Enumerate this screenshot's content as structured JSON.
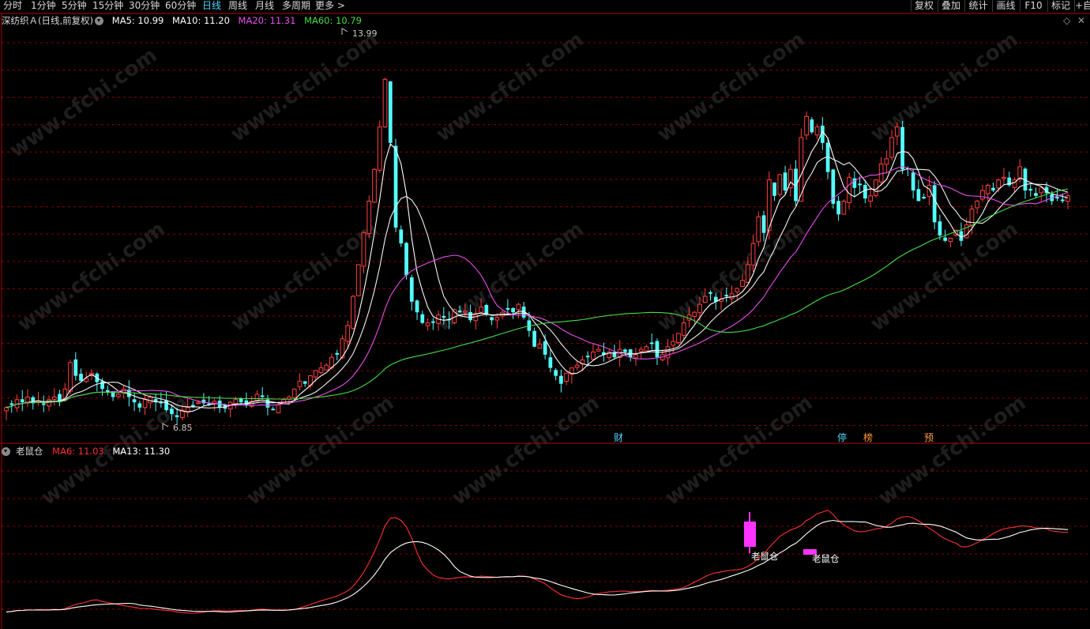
{
  "toolbar": {
    "periods": [
      "分时",
      "1分钟",
      "5分钟",
      "15分钟",
      "30分钟",
      "60分钟",
      "日线",
      "周线",
      "月线",
      "多周期",
      "更多 >"
    ],
    "active_period": "日线",
    "right_buttons": [
      "复权",
      "叠加",
      "统计",
      "画线",
      "F10",
      "标记",
      "+自"
    ],
    "pin_icons": [
      "diamond-icon",
      "close-icon"
    ]
  },
  "main_panel": {
    "title": "深纺织Ａ(日线,前复权)",
    "indicators": [
      {
        "label": "MA5: 10.99",
        "color": "#ffffff"
      },
      {
        "label": "MA10: 11.20",
        "color": "#ffffff"
      },
      {
        "label": "MA20: 11.31",
        "color": "#e84ee8"
      },
      {
        "label": "MA60: 10.79",
        "color": "#44dd44"
      }
    ],
    "high_label": "13.99",
    "low_label": "6.85",
    "event_markers": [
      {
        "text": "财",
        "color": "#4cd7ff"
      },
      {
        "text": "停",
        "color": "#4cd7ff"
      },
      {
        "text": "榜",
        "color": "#ff9b3a"
      },
      {
        "text": "预",
        "color": "#ff9b3a"
      }
    ]
  },
  "sub_panel": {
    "title": "老鼠仓",
    "indicators": [
      {
        "label": "MA6: 11.03",
        "color": "#ff3030"
      },
      {
        "label": "MA13: 11.30",
        "color": "#ffffff"
      }
    ],
    "signal_labels": [
      "老鼠仓",
      "老鼠仓"
    ]
  },
  "watermark": "www.cfchi.com",
  "colors": {
    "up": "#ff4040",
    "down": "#54ffff",
    "ma5": "#ffffff",
    "ma20": "#e84ee8",
    "ma60": "#44dd44",
    "grid": "#8b0000",
    "signal": "#ff33ff"
  },
  "chart_data": {
    "type": "candlestick",
    "title": "深纺织Ａ(日线,前复权)",
    "ylim": [
      6.5,
      14.5
    ],
    "closes": [
      7.1,
      7.15,
      7.25,
      7.2,
      7.3,
      7.18,
      7.22,
      7.15,
      7.25,
      7.3,
      7.2,
      7.45,
      7.95,
      7.7,
      7.6,
      7.65,
      7.75,
      7.58,
      7.45,
      7.38,
      7.3,
      7.35,
      7.45,
      7.3,
      7.2,
      7.1,
      7.25,
      7.3,
      7.2,
      7.18,
      7.05,
      6.98,
      6.92,
      7.05,
      7.1,
      7.12,
      7.2,
      7.18,
      7.15,
      7.22,
      7.1,
      7.08,
      7.2,
      7.25,
      7.2,
      7.15,
      7.22,
      7.35,
      7.3,
      7.1,
      7.05,
      7.15,
      7.25,
      7.3,
      7.45,
      7.6,
      7.55,
      7.7,
      7.8,
      7.85,
      7.9,
      8.05,
      8.1,
      8.4,
      8.65,
      9.2,
      9.8,
      10.4,
      11.0,
      11.6,
      12.4,
      13.3,
      12.1,
      10.5,
      10.2,
      9.6,
      9.1,
      8.9,
      8.7,
      8.7,
      8.7,
      8.85,
      8.8,
      8.75,
      8.95,
      8.9,
      8.92,
      8.75,
      8.85,
      9.0,
      8.85,
      8.75,
      8.8,
      8.9,
      8.95,
      8.9,
      9.05,
      8.8,
      8.55,
      8.25,
      8.3,
      8.1,
      7.85,
      7.7,
      7.55,
      7.75,
      7.85,
      7.9,
      8.0,
      8.05,
      8.15,
      8.2,
      8.1,
      8.15,
      8.05,
      8.2,
      8.15,
      8.05,
      8.1,
      8.2,
      8.25,
      8.3,
      8.05,
      8.1,
      8.25,
      8.35,
      8.5,
      8.7,
      8.85,
      8.9,
      9.05,
      9.2,
      9.25,
      9.1,
      9.15,
      9.2,
      9.25,
      9.35,
      9.5,
      9.8,
      10.2,
      10.7,
      10.4,
      11.4,
      11.1,
      11.5,
      11.2,
      11.6,
      11.0,
      12.2,
      12.6,
      12.3,
      12.4,
      12.1,
      11.55,
      10.95,
      10.75,
      11.0,
      11.45,
      11.25,
      11.3,
      11.05,
      11.1,
      11.4,
      11.7,
      11.8,
      12.2,
      12.4,
      11.6,
      11.6,
      11.2,
      11.0,
      11.05,
      11.3,
      10.6,
      10.35,
      10.25,
      10.3,
      10.45,
      10.25,
      10.55,
      10.85,
      11.0,
      11.2,
      11.3,
      11.2,
      11.4,
      11.45,
      11.3,
      11.4,
      11.65,
      11.2,
      11.2,
      11.1,
      11.25,
      11.15,
      11.0,
      11.05,
      11.0,
      11.1
    ]
  }
}
